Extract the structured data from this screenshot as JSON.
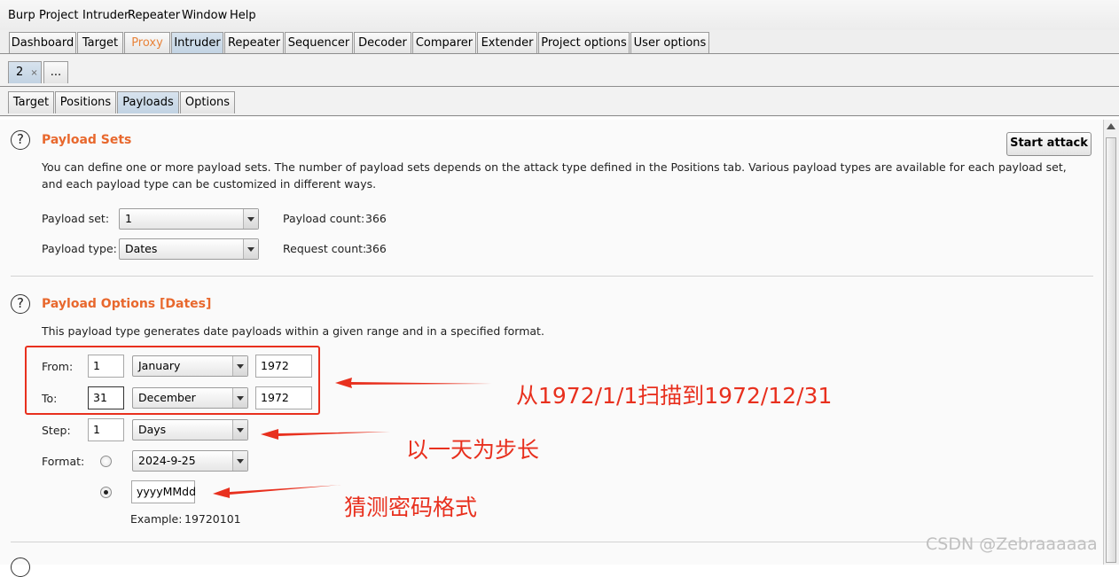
{
  "menu": [
    "Burp",
    "Project",
    "Intruder",
    "Repeater",
    "Window",
    "Help"
  ],
  "main_tabs": [
    "Dashboard",
    "Target",
    "Proxy",
    "Intruder",
    "Repeater",
    "Sequencer",
    "Decoder",
    "Comparer",
    "Extender",
    "Project options",
    "User options"
  ],
  "attack_tabs": {
    "current": "2",
    "close": "×",
    "more": "..."
  },
  "sub_tabs": [
    "Target",
    "Positions",
    "Payloads",
    "Options"
  ],
  "start_attack": "Start attack",
  "payload_sets": {
    "heading": "Payload Sets",
    "desc1": "You can define one or more payload sets. The number of payload sets depends on the attack type defined in the Positions tab. Various payload types are available for each payload set,",
    "desc2": "and each payload type can be customized in different ways.",
    "set_label": "Payload set:",
    "set_value": "1",
    "type_label": "Payload type:",
    "type_value": "Dates",
    "count_label": "Payload count:",
    "count_value": "366",
    "request_label": "Request count:",
    "request_value": "366"
  },
  "payload_options": {
    "heading": "Payload Options [Dates]",
    "desc": "This payload type generates date payloads within a given range and in a specified format.",
    "from_label": "From:",
    "from_day": "1",
    "from_month": "January",
    "from_year": "1972",
    "to_label": "To:",
    "to_day": "31",
    "to_month": "December",
    "to_year": "1972",
    "step_label": "Step:",
    "step_value": "1",
    "step_unit": "Days",
    "format_label": "Format:",
    "format_preset": "2024-9-25",
    "format_custom": "yyyyMMdd",
    "example_label": "Example:",
    "example_value": "19720101"
  },
  "annotations": {
    "range": "从1972/1/1扫描到1972/12/31",
    "step": "以一天为步长",
    "format": "猜测密码格式"
  },
  "watermark": "CSDN @Zebraaaaaa",
  "colors": {
    "heading": "#e8682d",
    "annotation": "#e8301e",
    "active_tab": "#c2d3e3"
  }
}
